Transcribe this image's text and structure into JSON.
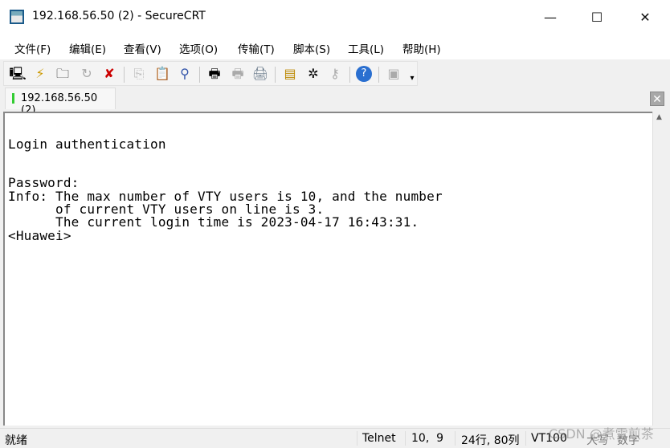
{
  "window": {
    "title": "192.168.56.50 (2) - SecureCRT",
    "minimize": "—",
    "maximize": "☐",
    "close": "✕"
  },
  "menu": [
    "文件(F)",
    "编辑(E)",
    "查看(V)",
    "选项(O)",
    "传输(T)",
    "脚本(S)",
    "工具(L)",
    "帮助(H)"
  ],
  "toolbar": {
    "icons": [
      "connect-icon",
      "quick-connect-icon",
      "connect-tab-icon",
      "reconnect-icon",
      "disconnect-icon",
      "copy-icon",
      "paste-icon",
      "find-icon",
      "print-screen-icon",
      "print-selection-icon",
      "printer-icon",
      "session-options-icon",
      "keymap-icon",
      "key-icon",
      "help-icon",
      "lock-icon"
    ],
    "more": "▾"
  },
  "tab": {
    "label": "192.168.56.50 (2)",
    "close": "✕",
    "status_color": "#33cc33"
  },
  "terminal": {
    "lines": [
      "",
      "",
      "Login authentication",
      "",
      "",
      "Password:",
      "Info: The max number of VTY users is 10, and the number",
      "      of current VTY users on line is 3.",
      "      The current login time is 2023-04-17 16:43:31.",
      "<Huawei>"
    ]
  },
  "status": {
    "ready": "就绪",
    "protocol": "Telnet",
    "cursor": "10,  9",
    "size": "24行, 80列",
    "emulation": "VT100",
    "caps": "大写",
    "num": "数字"
  },
  "watermark": "CSDN @煮雪煎茶"
}
